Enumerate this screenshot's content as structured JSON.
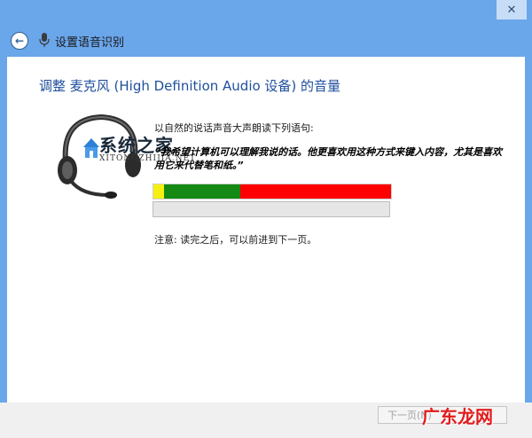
{
  "window": {
    "close_glyph": "✕"
  },
  "header": {
    "title": "设置语音识别"
  },
  "main": {
    "heading": "调整 麦克风 (High Definition Audio 设备) 的音量",
    "instruction": "以自然的说话声音大声朗读下列语句:",
    "sample_sentence": "“我希望计算机可以理解我说的话。他更喜欢用这种方式来键入内容，尤其是喜欢用它来代替笔和纸。”",
    "note": "注意: 读完之后，可以前进到下一页。",
    "volume_level": 0.98
  },
  "watermark": {
    "main": "系统之家",
    "sub": "XITONGZHIJIA.NET"
  },
  "footer": {
    "next_label": "下一页(N)",
    "site_mark": "广东龙网"
  },
  "colors": {
    "titlebar": "#6aa6ea",
    "heading": "#1e4f9c",
    "meter_yellow": "#f6ef12",
    "meter_green": "#148a14",
    "meter_red": "#ff0000"
  }
}
